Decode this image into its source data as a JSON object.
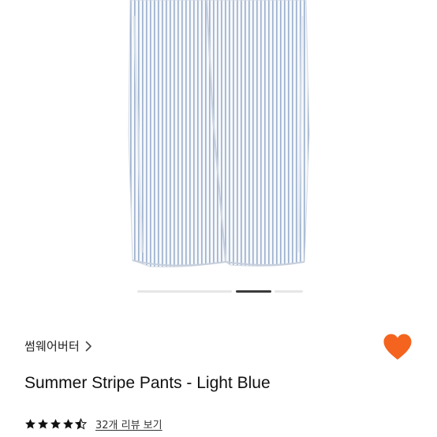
{
  "product": {
    "brand": "썸웨어버터",
    "brand_chevron": "chevron-right-icon",
    "title": "Summer Stripe Pants - Light Blue",
    "liked": true,
    "like_icon": "heart-icon",
    "rating": 4.5,
    "rating_max": 5,
    "review_link": "32개 리뷰 보기"
  },
  "gallery": {
    "image": "striped-pants-photo",
    "slide_count": 4,
    "active_slide": 2
  },
  "colors": {
    "accent": "#F4641E",
    "text": "#111111",
    "indicator_active": "#3a3a3a",
    "indicator_inactive": "#e6e6e6",
    "background_image": "#f7f6f4"
  }
}
